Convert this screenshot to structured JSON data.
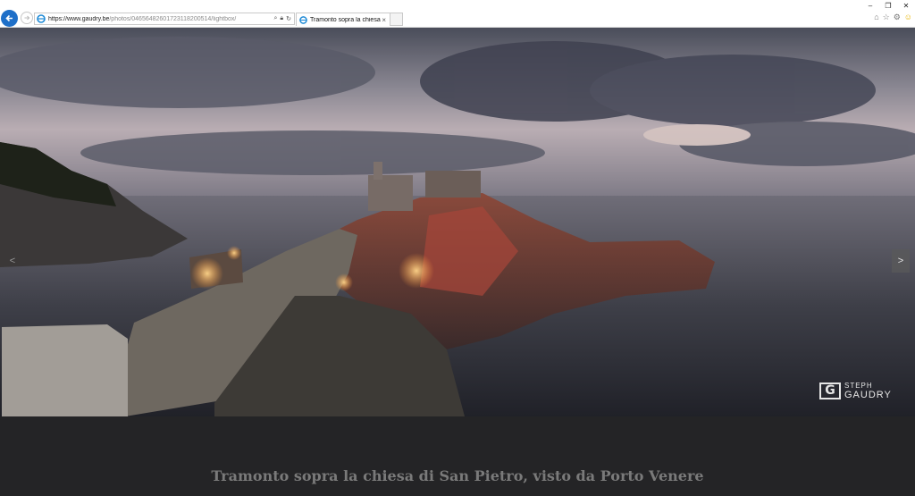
{
  "browser": {
    "url_prefix": "https://",
    "url_host": "www.gaudry.be",
    "url_path": "/photos/04656482601723118200514/lightbox/",
    "tab_title": "Tramonto sopra la chiesa di...",
    "tab_close": "×",
    "window_controls": [
      "–",
      "❐",
      "✕"
    ],
    "toolbar_icons": [
      "home-icon",
      "star-icon",
      "gear-icon",
      "smiley-icon"
    ]
  },
  "lightbox": {
    "prev_arrow": "<",
    "next_arrow": ">",
    "watermark_logo": "G",
    "watermark_line1": "STEPH",
    "watermark_line2": "GAUDRY",
    "caption": "Tramonto sopra la chiesa di San Pietro, visto da Porto Venere"
  },
  "colors": {
    "back_button": "#1e6fc8",
    "caption_text": "#7a7a7a",
    "caption_background": "#242426"
  }
}
